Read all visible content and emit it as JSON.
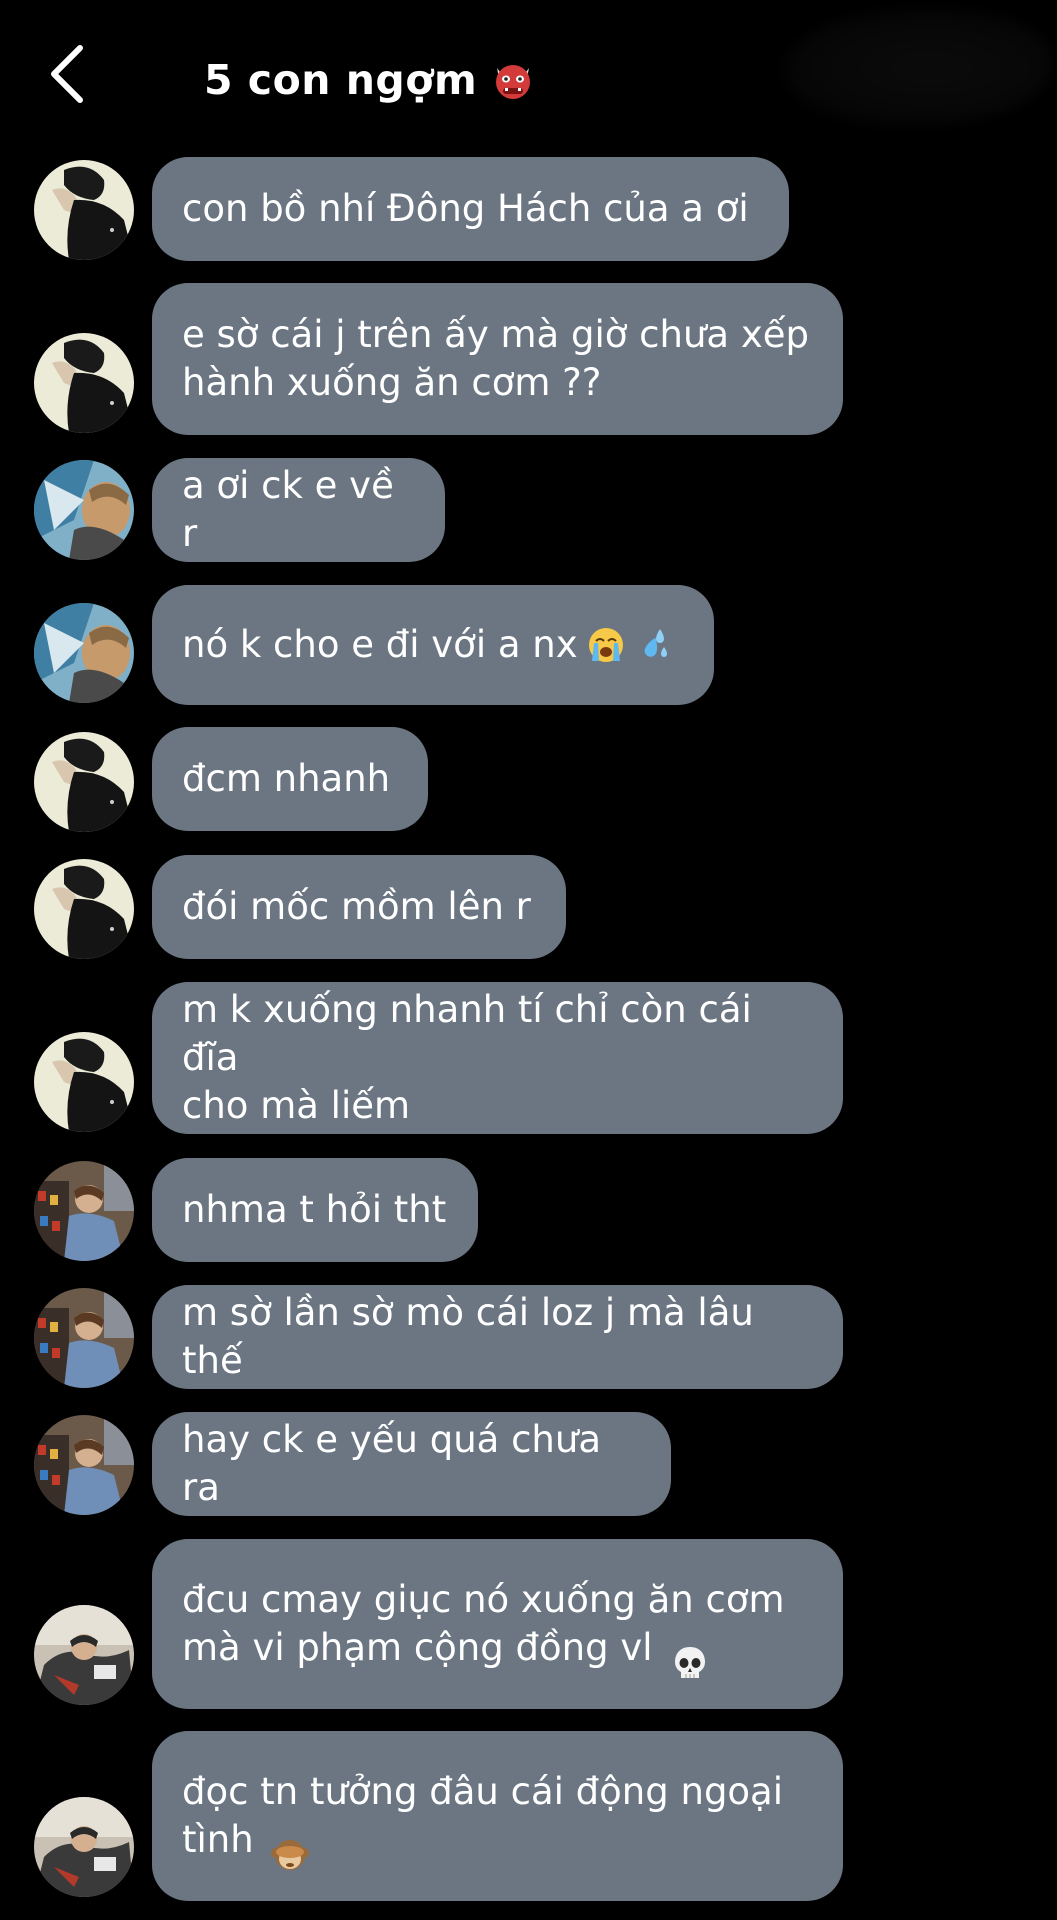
{
  "header": {
    "title": "5 con ngợm",
    "title_emoji": "ogre-emoji"
  },
  "messages": [
    {
      "avatar": "avatar-1",
      "text": "con bồ nhí Đông Hách của a ơi"
    },
    {
      "avatar": "avatar-1",
      "text": "e sờ cái j trên ấy mà giờ chưa xếp\nhành xuống ăn cơm ??"
    },
    {
      "avatar": "avatar-2",
      "text": "a ơi ck e về r"
    },
    {
      "avatar": "avatar-2",
      "text": "nó k cho e đi với a nx",
      "emojis": [
        "loudly-crying-face-emoji",
        "sweat-droplets-emoji"
      ]
    },
    {
      "avatar": "avatar-1",
      "text": "đcm nhanh"
    },
    {
      "avatar": "avatar-1",
      "text": "đói mốc mồm lên r"
    },
    {
      "avatar": "avatar-1",
      "text": "m k xuống nhanh tí chỉ còn cái đĩa\ncho mà liếm"
    },
    {
      "avatar": "avatar-3",
      "text": "nhma t hỏi tht"
    },
    {
      "avatar": "avatar-3",
      "text": "m sờ lần sờ mò cái loz j mà lâu thế"
    },
    {
      "avatar": "avatar-3",
      "text": "hay ck e yếu quá chưa ra"
    },
    {
      "avatar": "avatar-4",
      "text": "đcu cmay giục nó xuống ăn cơm\nmà vi phạm cộng đồng vl",
      "emojis": [
        "skull-emoji"
      ]
    },
    {
      "avatar": "avatar-4",
      "text": "đọc tn tưởng đâu cái động ngoại\ntình",
      "emojis": [
        "see-no-evil-monkey-emoji"
      ]
    }
  ]
}
